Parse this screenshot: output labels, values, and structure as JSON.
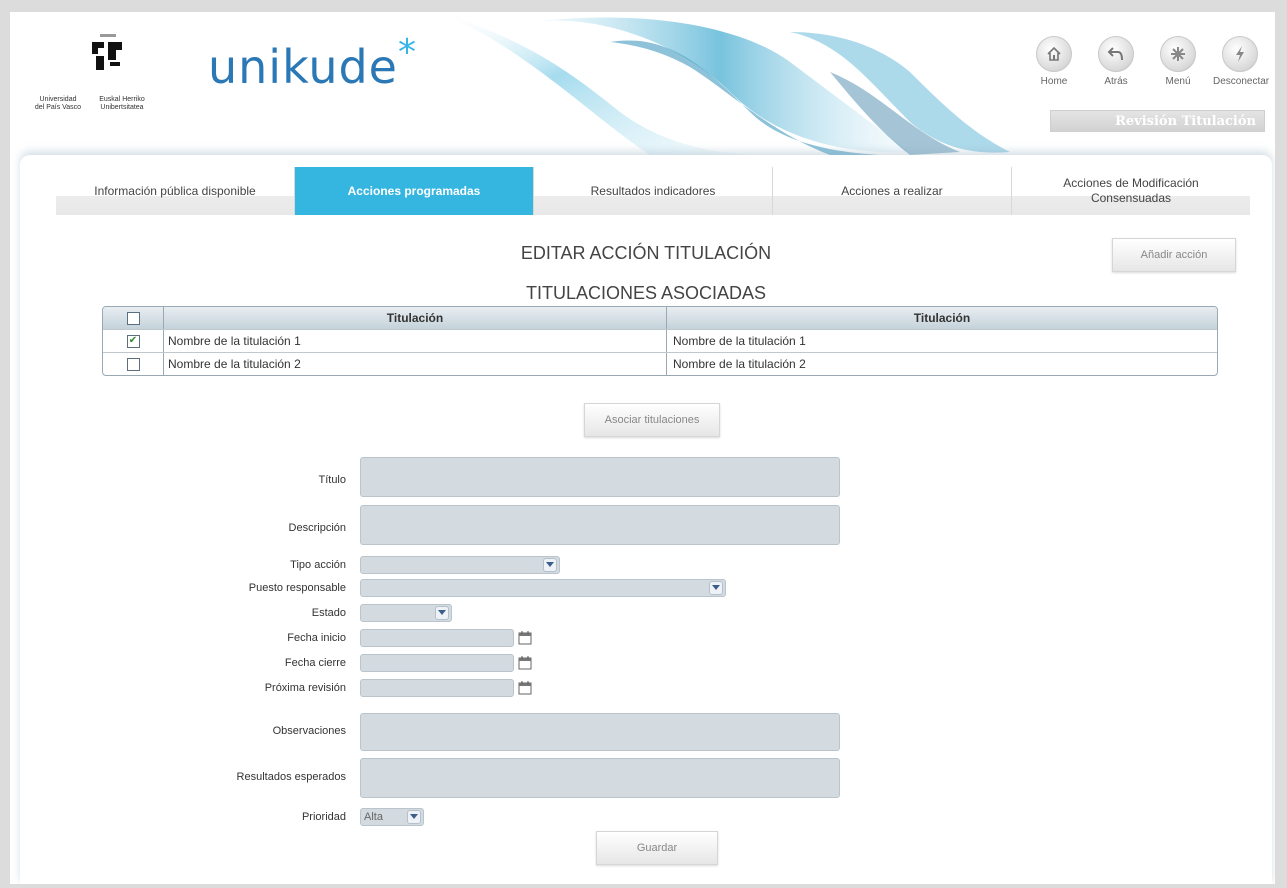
{
  "header": {
    "university": {
      "line1": "Universidad\ndel País Vasco",
      "line2": "Euskal Herriko\nUnibertsitatea"
    },
    "brand": {
      "name": "unikude",
      "star": "*"
    },
    "nav": [
      {
        "label": "Home",
        "icon": "home-icon"
      },
      {
        "label": "Atrás",
        "icon": "back-arrow-icon"
      },
      {
        "label": "Menú",
        "icon": "menu-snowflake-icon"
      },
      {
        "label": "Desconectar",
        "icon": "lightning-icon"
      }
    ],
    "section_badge": "Revisión Titulación"
  },
  "tabs": [
    {
      "label": "Información pública disponible",
      "sub": "",
      "active": false
    },
    {
      "label": "Acciones programadas",
      "sub": "",
      "active": true
    },
    {
      "label": "Resultados indicadores",
      "sub": "",
      "active": false
    },
    {
      "label": "Acciones a realizar",
      "sub": "",
      "active": false
    },
    {
      "label": "Acciones de Modificación",
      "sub": "Consensuadas",
      "active": false
    }
  ],
  "page": {
    "title": "EDITAR ACCIÓN TITULACIÓN",
    "add_action_label": "Añadir acción",
    "associated_title": "TITULACIONES ASOCIADAS",
    "associate_button": "Asociar titulaciones",
    "save_button": "Guardar"
  },
  "table": {
    "headers": [
      "Titulación",
      "Titulación"
    ],
    "rows": [
      {
        "checked": true,
        "a": "Nombre de la titulación 1",
        "b": "Nombre de la titulación 1"
      },
      {
        "checked": false,
        "a": "Nombre de la titulación 2",
        "b": "Nombre de la titulación 2"
      }
    ]
  },
  "form": {
    "titulo": "Título",
    "descripcion": "Descripción",
    "tipo_accion": "Tipo acción",
    "puesto_responsable": "Puesto responsable",
    "estado": "Estado",
    "fecha_inicio": "Fecha inicio",
    "fecha_cierre": "Fecha cierre",
    "proxima_revision": "Próxima revisión",
    "observaciones": "Observaciones",
    "resultados_esperados": "Resultados esperados",
    "prioridad": "Prioridad",
    "prioridad_value": "Alta"
  },
  "colors": {
    "accent": "#35b6e0",
    "brand": "#2b78b6",
    "field": "#d3dbe1"
  }
}
